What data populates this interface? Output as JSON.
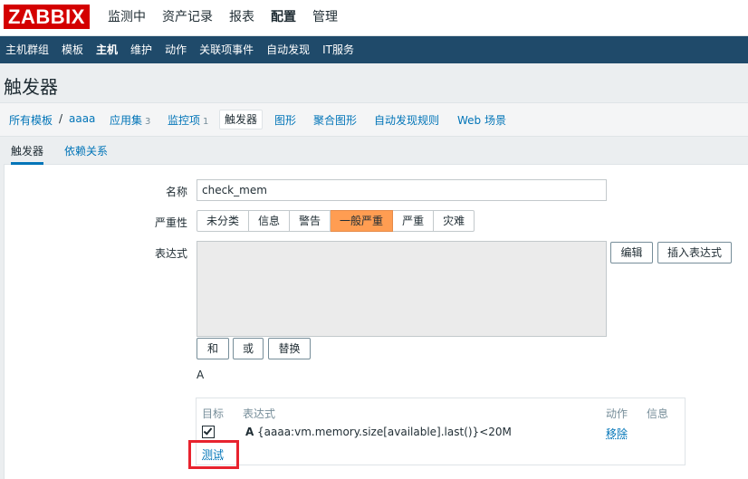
{
  "logo": "ZABBIX",
  "top_menu": [
    "监测中",
    "资产记录",
    "报表",
    "配置",
    "管理"
  ],
  "top_menu_selected": "配置",
  "sub_menu": [
    "主机群组",
    "模板",
    "主机",
    "维护",
    "动作",
    "关联项事件",
    "自动发现",
    "IT服务"
  ],
  "sub_menu_selected": "主机",
  "page_title": "触发器",
  "host_nav": {
    "all_templates": "所有模板",
    "separator": "/",
    "host": "aaaa",
    "applications": "应用集",
    "applications_count": "3",
    "items": "监控项",
    "items_count": "1",
    "triggers": "触发器",
    "graphs": "图形",
    "screens": "聚合图形",
    "discovery": "自动发现规则",
    "web": "Web 场景"
  },
  "tabs": [
    "触发器",
    "依赖关系"
  ],
  "form": {
    "name_label": "名称",
    "name_value": "check_mem",
    "severity_label": "严重性",
    "severity_options": [
      "未分类",
      "信息",
      "警告",
      "一般严重",
      "严重",
      "灾难"
    ],
    "severity_selected": "一般严重",
    "expression_label": "表达式",
    "edit_button": "编辑",
    "insert_button": "插入表达式",
    "and_button": "和",
    "or_button": "或",
    "replace_button": "替换",
    "expression_preview": "A"
  },
  "expression_table": {
    "headers": [
      "目标",
      "表达式",
      "动作",
      "信息"
    ],
    "row": {
      "checked": true,
      "id": "A",
      "expression": "{aaaa:vm.memory.size[available].last()}<20M",
      "action": "移除"
    },
    "test_link": "测试"
  },
  "colors": {
    "logo_bg": "#d40000",
    "subnav_bg": "#1f4a6a",
    "selected_severity": "#ff9d52",
    "link": "#0275b8",
    "highlight_border": "#e8232e"
  }
}
